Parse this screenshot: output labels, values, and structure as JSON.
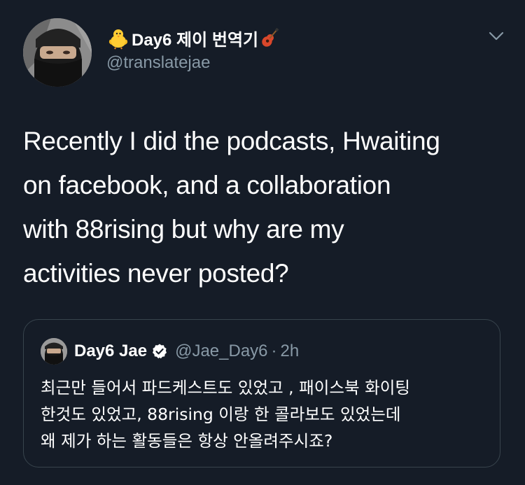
{
  "tweet": {
    "author": {
      "display_name": "Day6 제이 번역기",
      "display_name_prefix_emoji": "chick-emoji",
      "display_name_suffix_emoji": "guitar-emoji",
      "handle": "@translatejae"
    },
    "text": "Recently I did the podcasts, Hwaiting\non facebook, and a collaboration\nwith 88rising but why are my\nactivities never posted?",
    "menu_icon": "chevron-down-icon"
  },
  "quoted_tweet": {
    "author": {
      "display_name": "Day6 Jae",
      "verified_icon": "verified-badge-icon",
      "handle": "@Jae_Day6",
      "separator": "·",
      "time": "2h"
    },
    "text": "최근만 들어서 파드케스트도 있었고 , 패이스북 화이팅\n한것도 있었고, 88rising 이랑 한 콜라보도 있었는데\n왜 제가 하는 활동들은 항상 안올려주시죠?"
  },
  "colors": {
    "background": "#151c27",
    "primary_text": "#ffffff",
    "secondary_text": "#8899a6",
    "border": "#38444d"
  }
}
